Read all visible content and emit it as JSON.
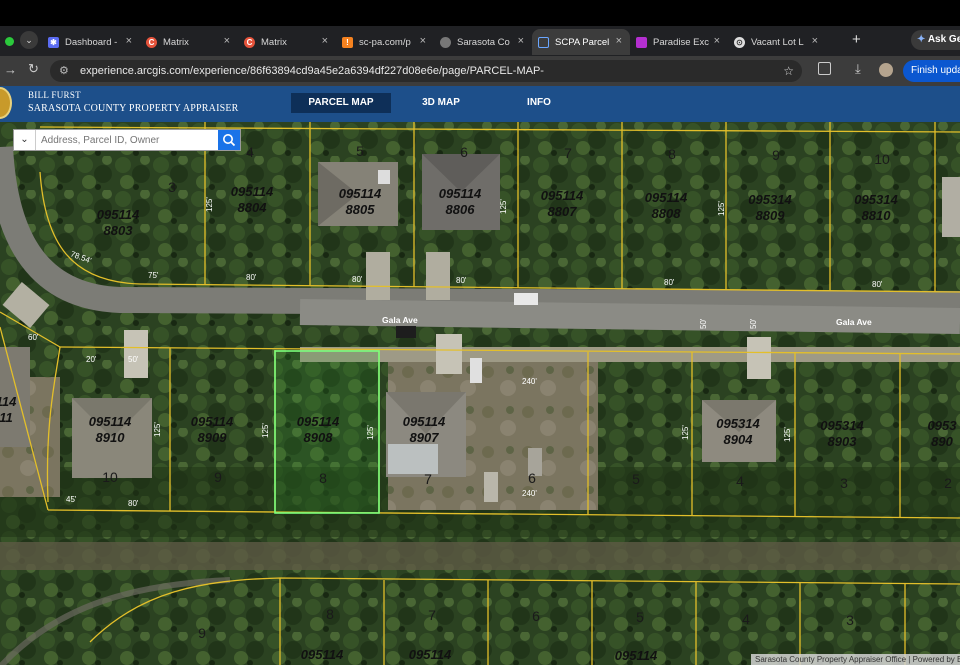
{
  "browser": {
    "tabs": [
      {
        "label": "Dashboard -",
        "favicon": "dashboard-favicon",
        "color": "#5b6cf2"
      },
      {
        "label": "Matrix",
        "favicon": "matrix-favicon",
        "color": "#e5533b"
      },
      {
        "label": "Matrix",
        "favicon": "matrix-favicon",
        "color": "#e5533b"
      },
      {
        "label": "sc-pa.com/p",
        "favicon": "scpa-favicon",
        "color": "#f5821f"
      },
      {
        "label": "Sarasota Co",
        "favicon": "globe-favicon",
        "color": "#9aa0a6"
      },
      {
        "label": "SCPA Parcel",
        "favicon": "arcgis-favicon",
        "color": "#1f7ae0"
      },
      {
        "label": "Paradise Exc",
        "favicon": "paradise-favicon",
        "color": "#b42fd0"
      },
      {
        "label": "Vacant Lot L",
        "favicon": "vacant-favicon",
        "color": "#dddddd"
      }
    ],
    "ask_label": "Ask Ge",
    "url": "experience.arcgis.com/experience/86f63894cd9a45e2a6394df227d08e6e/page/PARCEL-MAP-",
    "finish_update_label": "Finish update"
  },
  "app": {
    "brand_line1": "BILL FURST",
    "brand_line2": "SARASOTA COUNTY PROPERTY APPRAISER",
    "nav": [
      {
        "label": "PARCEL MAP",
        "active": true
      },
      {
        "label": "3D MAP",
        "active": false
      },
      {
        "label": "INFO",
        "active": false
      }
    ],
    "search_placeholder": "Address, Parcel ID, Owner"
  },
  "map": {
    "streets": [
      {
        "name": "Gala Ave"
      },
      {
        "name": "Gala Ave"
      }
    ],
    "parcels_north": [
      {
        "id": "095114 8803",
        "lot": "3"
      },
      {
        "id": "095114 8804",
        "lot": "4"
      },
      {
        "id": "095114 8805",
        "lot": "5"
      },
      {
        "id": "095114 8806",
        "lot": "6"
      },
      {
        "id": "095114 8807",
        "lot": "7"
      },
      {
        "id": "095114 8808",
        "lot": "8"
      },
      {
        "id": "095314 8809",
        "lot": "9"
      },
      {
        "id": "095314 8810",
        "lot": "10"
      }
    ],
    "parcels_south": [
      {
        "id": "095114 8910",
        "lot": "10"
      },
      {
        "id": "095114 8909",
        "lot": "9"
      },
      {
        "id": "095114 8908",
        "lot": "8",
        "selected": true
      },
      {
        "id": "095114 8907",
        "lot": "7"
      },
      {
        "id": "",
        "lot": "6"
      },
      {
        "id": "",
        "lot": "5"
      },
      {
        "id": "095314 8904",
        "lot": "4"
      },
      {
        "id": "095314 8903",
        "lot": "3"
      },
      {
        "id": "0953 890",
        "lot": "2"
      }
    ],
    "left_partial_id": "114 11",
    "bottom_lots": [
      "9",
      "8",
      "7",
      "6",
      "5",
      "4",
      "3"
    ],
    "bottom_ids": [
      "095114",
      "095114",
      "095114"
    ],
    "dimension_labels": [
      "80'",
      "80'",
      "80'",
      "80'",
      "80'",
      "80'",
      "75'",
      "125'",
      "125'",
      "125'",
      "125'",
      "125'",
      "125'",
      "125'",
      "125'",
      "50'",
      "50'",
      "50'",
      "20'",
      "60'",
      "45'",
      "240'",
      "240'",
      "78.54'"
    ],
    "attribution": "Sarasota County Property Appraiser Office | Powered by Esri"
  },
  "colors": {
    "header_blue": "#1d4f8a",
    "nav_active": "#0e2f58",
    "parcel_line": "#e3bf2a",
    "selected_parcel": "#7cff7c",
    "search_button": "#1a73e8"
  }
}
